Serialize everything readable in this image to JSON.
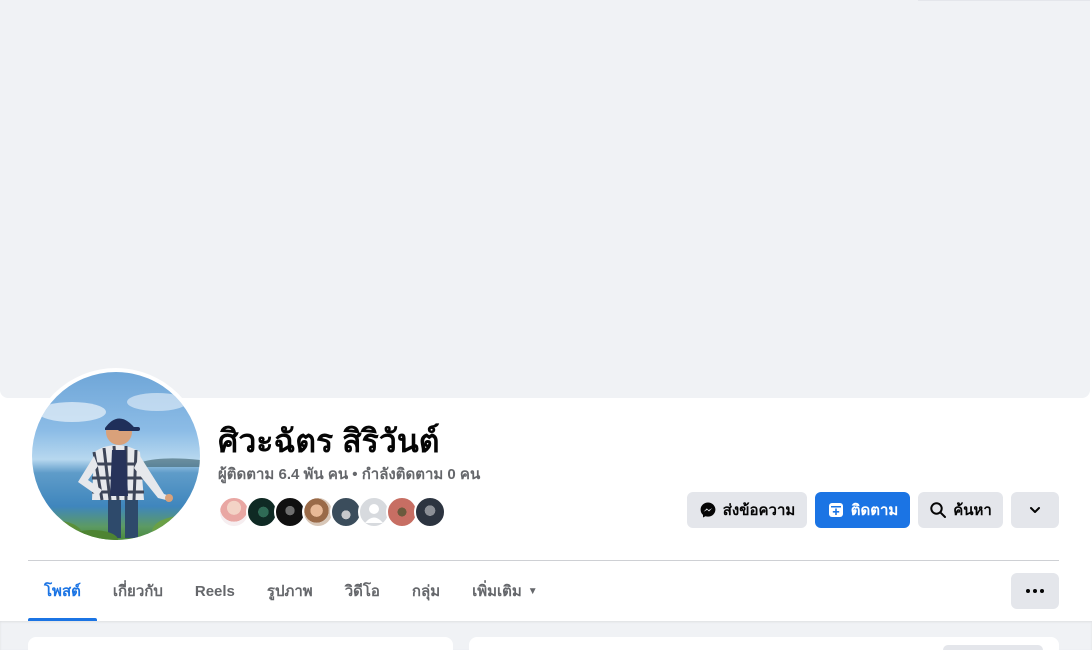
{
  "profile": {
    "name": "ศิวะฉัตร สิริวันต์",
    "stats": "ผู้ติดตาม 6.4 พัน คน • กำลังติดตาม 0 คน",
    "friend_avatars": [
      "friend-1",
      "friend-2",
      "friend-3",
      "friend-4",
      "friend-5",
      "friend-6",
      "friend-7",
      "friend-8"
    ]
  },
  "actions": {
    "message_label": "ส่งข้อความ",
    "follow_label": "ติดตาม",
    "search_label": "ค้นหา"
  },
  "tabs": [
    {
      "label": "โพสต์",
      "active": true
    },
    {
      "label": "เกี่ยวกับ",
      "active": false
    },
    {
      "label": "Reels",
      "active": false
    },
    {
      "label": "รูปภาพ",
      "active": false
    },
    {
      "label": "วิดีโอ",
      "active": false
    },
    {
      "label": "กลุ่ม",
      "active": false
    },
    {
      "label": "เพิ่มเติม",
      "active": false
    }
  ],
  "icons": {
    "messenger": "messenger-icon",
    "follow": "follow-icon",
    "search": "search-icon",
    "chevron": "chevron-down-icon",
    "more": "more-icon"
  },
  "colors": {
    "accent": "#1b74e4",
    "button_grey": "#e4e6eb",
    "cover": "#f0f2f5",
    "secondary_text": "#65676b"
  }
}
